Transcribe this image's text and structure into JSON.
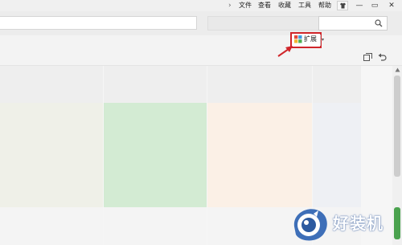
{
  "titlebar": {
    "chevron": "›",
    "menu": [
      "文件",
      "查看",
      "收藏",
      "工具",
      "帮助"
    ],
    "window_buttons": {
      "skin": "skin-icon",
      "minimize": "—",
      "maximize": "▭",
      "close": "✕"
    }
  },
  "address": {
    "url_value": "",
    "search_value": "",
    "search_icon": "search-icon"
  },
  "toolbar": {
    "extensions_label": "扩展",
    "extensions_icon": "extensions-grid-icon",
    "dropdown": "▾",
    "highlight_color": "#d0252a"
  },
  "tiles": {
    "colors": [
      "#eff0e8",
      "#d3ebd3",
      "#fbf0e6",
      "#eef0f4"
    ]
  },
  "watermark": {
    "text": "好装机"
  }
}
